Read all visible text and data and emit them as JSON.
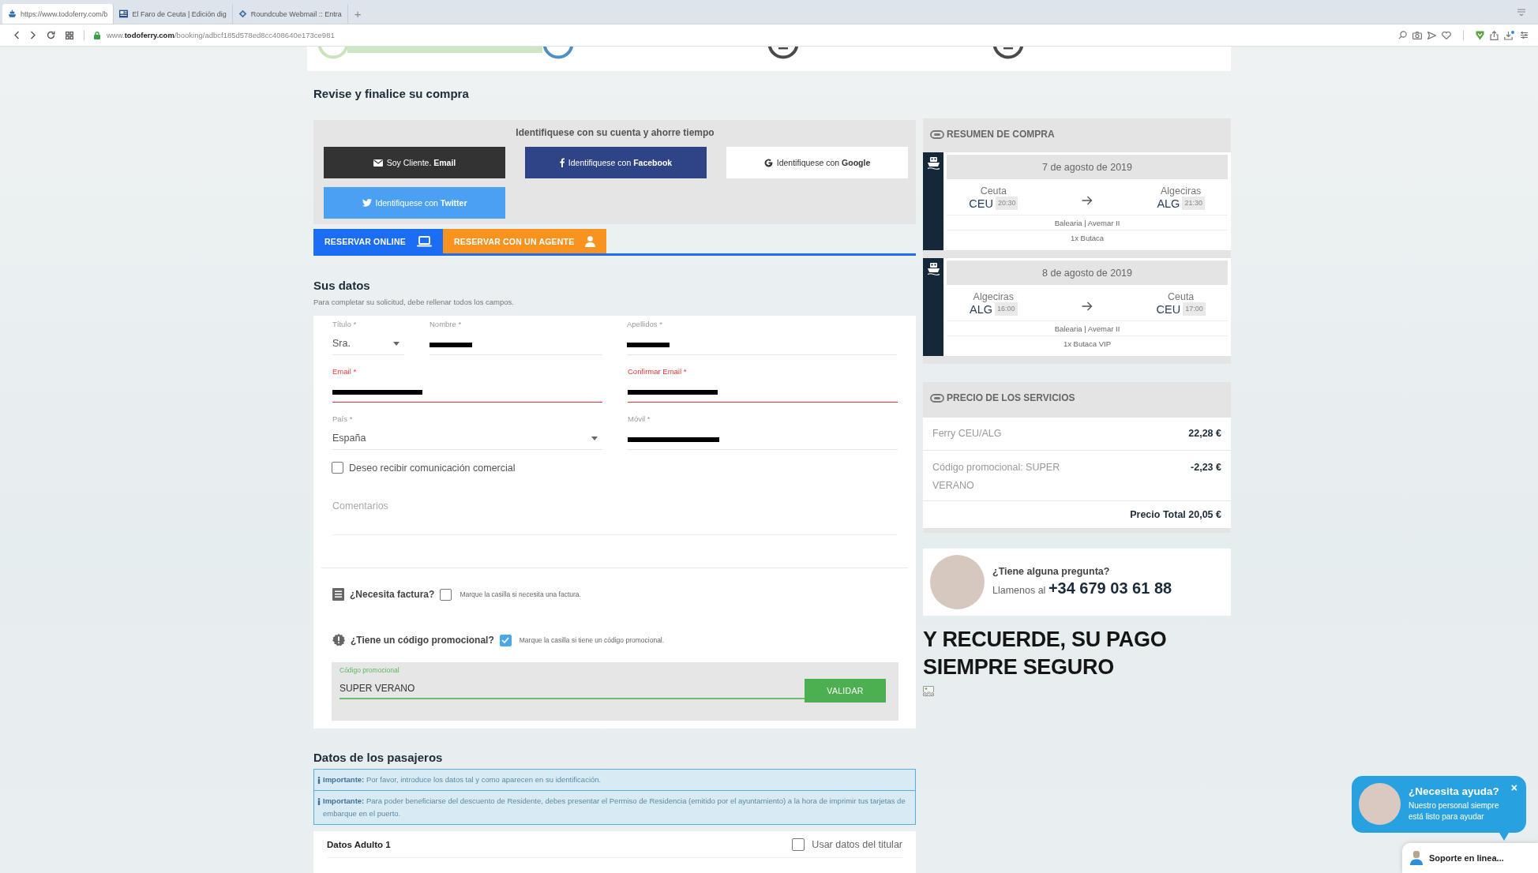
{
  "browser": {
    "tabs": [
      {
        "kind": "ferry",
        "title": "https://www.todoferry.com/b",
        "selected": true
      },
      {
        "kind": "news",
        "title": "El Faro de Ceuta | Edición dig",
        "selected": false
      },
      {
        "kind": "mail",
        "title": "Roundcube Webmail :: Entra",
        "selected": false
      }
    ],
    "new_tab": "+",
    "url": "www.**todoferry.com**/booking/adbcf185d578ed8cc408640e173ce981"
  },
  "steps": [
    {
      "completed": true,
      "selected": false
    },
    {
      "completed": false,
      "selected": true
    },
    {
      "completed": false,
      "selected": false
    },
    {
      "completed": false,
      "selected": false
    }
  ],
  "page_title": "Revise y finalice su compra",
  "login": {
    "title": "Identifiquese con su cuenta y ahorre tiempo",
    "buttons": [
      {
        "kind": "email",
        "label": "Soy Cliente. **Email**"
      },
      {
        "kind": "facebook",
        "label": "Identifiquese con **Facebook**"
      },
      {
        "kind": "google",
        "label": "Identifiquese con **Google**"
      },
      {
        "kind": "twitter",
        "label": "Identifiquese con **Twitter**"
      }
    ]
  },
  "booking_tabs": [
    {
      "kind": "online",
      "label": "RESERVAR ONLINE",
      "selected": true
    },
    {
      "kind": "agent",
      "label": "RESERVAR CON UN AGENTE",
      "selected": false
    }
  ],
  "your_data": {
    "title": "Sus datos",
    "subtitle": "Para completar su solicitud, debe rellenar todos los campos.",
    "rows": [
      [
        {
          "kind": "select",
          "label": "Título *",
          "value": "Sra.",
          "error": false,
          "redacted": false
        },
        {
          "kind": "text",
          "label": "Nombre *",
          "error": false,
          "redacted": true
        },
        {
          "kind": "text",
          "label": "Apellidos *",
          "error": false,
          "redacted": true
        }
      ],
      [
        {
          "kind": "email",
          "label": "Email *",
          "error": true,
          "redacted": true
        },
        {
          "kind": "email",
          "label": "Confirmar Email *",
          "error": true,
          "redacted": true
        }
      ],
      [
        {
          "kind": "select",
          "label": "País *",
          "value": "España",
          "error": false,
          "redacted": false
        },
        {
          "kind": "phone",
          "label": "Móvil *",
          "error": false,
          "redacted": true
        }
      ]
    ],
    "newsletter": {
      "label": "Deseo recibir comunicación comercial",
      "checked": false
    },
    "comments": {
      "placeholder": "Comentarios"
    },
    "extras": [
      {
        "kind": "invoice",
        "title": "¿Necesita factura?",
        "hint": "Marque la casilla si necesita una factura.",
        "checked": false
      },
      {
        "kind": "promo",
        "title": "¿Tiene un código promocional?",
        "hint": "Marque la casilla si tiene un código promocional.",
        "checked": true,
        "code_label": "Código promocional",
        "code": "SUPER VERANO",
        "button": "VALIDAR"
      }
    ]
  },
  "passengers": {
    "title": "Datos de los pasajeros",
    "notices": [
      "**Importante:** Por favor, introduce los datos tal y como aparecen en su identificación.",
      "**Importante:** Para poder beneficiarse del descuento de Residente, debes presentar el Permiso de Residencia (emitido por el ayuntamiento) a la hora de imprimir tus tarjetas de embarque en el puerto."
    ],
    "adults": [
      {
        "title": "Datos Adulto 1",
        "use_holder_label": "Usar datos del titular",
        "use_holder_checked": false
      }
    ]
  },
  "summary": {
    "title": "RESUMEN DE COMPRA",
    "legs": [
      {
        "date": "7 de agosto de 2019",
        "from": {
          "city": "Ceuta",
          "code": "CEU",
          "time": "20:30"
        },
        "to": {
          "city": "Algeciras",
          "code": "ALG",
          "time": "21:30"
        },
        "operator": "Balearia | Avemar II",
        "fare": "1x Butaca"
      },
      {
        "date": "8 de agosto de 2019",
        "from": {
          "city": "Algeciras",
          "code": "ALG",
          "time": "16:00"
        },
        "to": {
          "city": "Ceuta",
          "code": "CEU",
          "time": "17:00"
        },
        "operator": "Balearia | Avemar II",
        "fare": "1x Butaca VIP"
      }
    ]
  },
  "prices": {
    "title": "PRECIO DE LOS SERVICIOS",
    "items": [
      {
        "label": "Ferry CEU/ALG",
        "amount": "22,28 €"
      },
      {
        "label": "Código promocional: SUPER VERANO",
        "amount": "-2,23 €"
      }
    ],
    "total": "Precio Total 20,05 €"
  },
  "support": {
    "question": "¿Tiene alguna pregunta?",
    "call": "Llamenos al **+34 679 03 61 88**"
  },
  "secure_banner": "Y RECUERDE, SU PAGO SIEMPRE SEGURO",
  "chat": {
    "title": "¿Necesita ayuda?",
    "text": "Nuestro personal siempre está listo para ayudar",
    "close": "×",
    "online_label": "Soporte en linea..."
  }
}
